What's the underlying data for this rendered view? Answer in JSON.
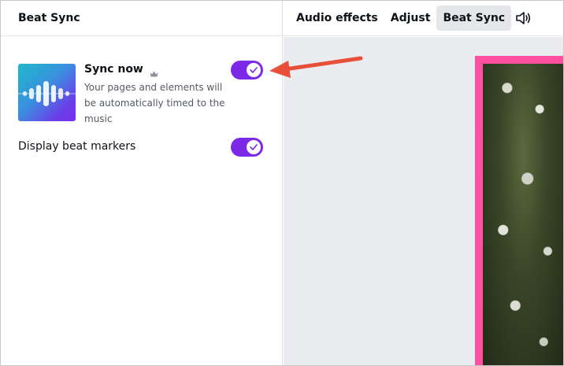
{
  "panel": {
    "title": "Beat Sync",
    "sync": {
      "title": "Sync now",
      "description": "Your pages and elements will be automatically timed to the music",
      "enabled": true,
      "thumbnail_icon": "waveform-icon",
      "premium_icon": "crown-icon"
    },
    "beat_markers": {
      "label": "Display beat markers",
      "enabled": true
    }
  },
  "toolbar": {
    "audio_effects_label": "Audio effects",
    "adjust_label": "Adjust",
    "beat_sync_label": "Beat Sync",
    "volume_icon": "speaker-icon"
  },
  "colors": {
    "toggle_on": "#7d2ae8",
    "page_border": "#ff4fa0",
    "annotation_arrow": "#e8503a",
    "canvas_bg": "#ebecf0"
  }
}
